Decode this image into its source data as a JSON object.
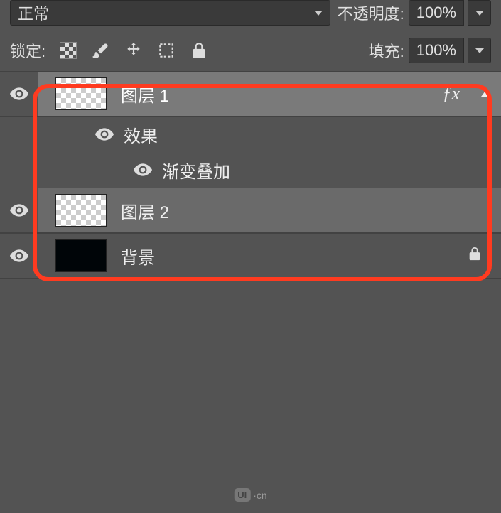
{
  "top": {
    "blend_mode": "正常",
    "opacity_label": "不透明度:",
    "opacity_value": "100%"
  },
  "lock_row": {
    "label": "锁定:",
    "fill_label": "填充:",
    "fill_value": "100%"
  },
  "layers": {
    "layer1": {
      "name": "图层 1",
      "fx": "ƒx"
    },
    "effects_label": "效果",
    "gradient_overlay": "渐变叠加",
    "layer2": {
      "name": "图层 2"
    },
    "background": {
      "name": "背景"
    }
  },
  "footer": {
    "brand": "UI",
    "suffix": "·cn"
  }
}
